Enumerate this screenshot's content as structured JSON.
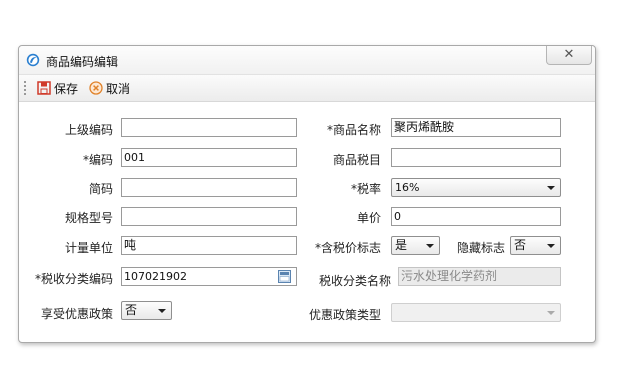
{
  "window": {
    "title": "商品编码编辑",
    "close_symbol": "✕"
  },
  "toolbar": {
    "save_label": "保存",
    "cancel_label": "取消"
  },
  "form": {
    "parent_code_label": "上级编码",
    "parent_code_value": "",
    "product_name_label": "*商品名称",
    "product_name_value": "聚丙烯酰胺",
    "code_label": "*编码",
    "code_value": "001",
    "tax_item_label": "商品税目",
    "tax_item_value": "",
    "short_code_label": "简码",
    "short_code_value": "",
    "tax_rate_label": "*税率",
    "tax_rate_value": "16%",
    "spec_label": "规格型号",
    "spec_value": "",
    "unit_price_label": "单价",
    "unit_price_value": "0",
    "unit_label": "计量单位",
    "unit_value": "吨",
    "tax_inclusive_label": "*含税价标志",
    "tax_inclusive_value": "是",
    "hidden_flag_label": "隐藏标志",
    "hidden_flag_value": "否",
    "tax_class_code_label": "*税收分类编码",
    "tax_class_code_value": "107021902",
    "tax_class_name_label": "税收分类名称",
    "tax_class_name_value": "污水处理化学药剂",
    "preferential_label": "享受优惠政策",
    "preferential_value": "否",
    "policy_type_label": "优惠政策类型",
    "policy_type_value": ""
  },
  "colors": {
    "save_icon": "#d03a2a",
    "cancel_icon": "#e0822a",
    "app_icon": "#2a7fd0"
  }
}
